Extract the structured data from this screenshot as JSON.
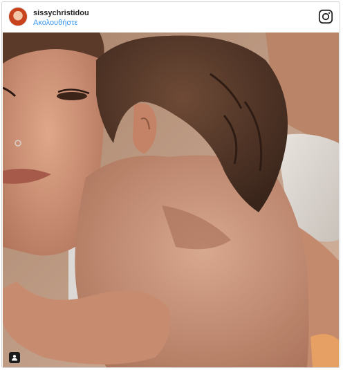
{
  "post": {
    "username": "sissychristidou",
    "follow_label": "Ακολουθήστε"
  },
  "icons": {
    "brand": "instagram-icon",
    "tag": "user-tag-icon",
    "avatar": "avatar"
  },
  "colors": {
    "link": "#3897f0",
    "username": "#262626",
    "border": "#d4d4d4"
  }
}
